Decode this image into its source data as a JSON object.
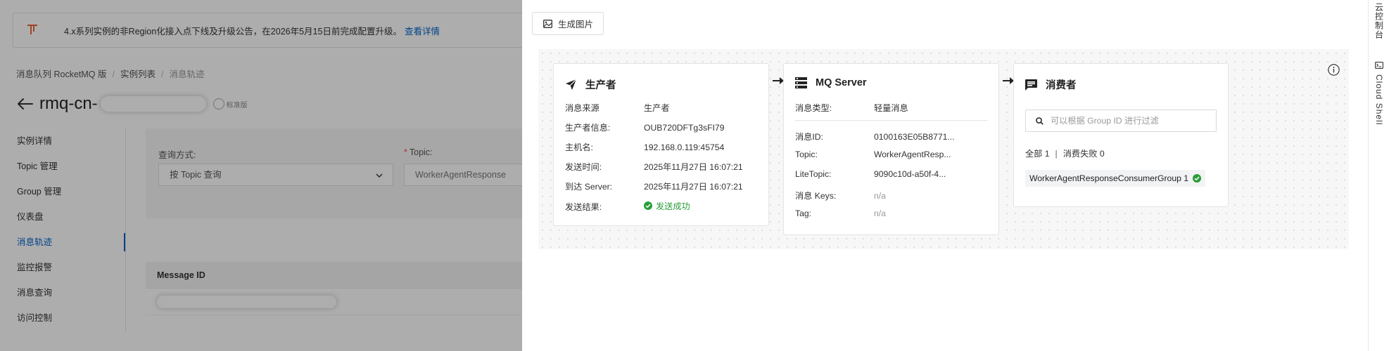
{
  "notice": {
    "text": "4.x系列实例的非Region化接入点下线及升级公告，在2026年5月15日前完成配置升级。",
    "link": "查看详情"
  },
  "breadcrumb": [
    "消息队列 RocketMQ 版",
    "实例列表",
    "消息轨迹"
  ],
  "instance": {
    "name": "rmq-cn-",
    "tag": "标准版"
  },
  "side_nav": {
    "items": [
      "实例详情",
      "Topic 管理",
      "Group 管理",
      "仪表盘",
      "消息轨迹",
      "监控报警",
      "消息查询",
      "访问控制"
    ],
    "active_index": 4
  },
  "query": {
    "method_label": "查询方式:",
    "method_value": "按 Topic 查询",
    "topic_label": "Topic:",
    "topic_value": "WorkerAgentResponse"
  },
  "table": {
    "header": "Message ID"
  },
  "drawer": {
    "generate_button": "生成图片",
    "producer": {
      "title": "生产者",
      "rows": [
        {
          "key": "消息来源",
          "value": "生产者"
        },
        {
          "key": "生产者信息:",
          "value": "OUB720DFTg3sFI79"
        },
        {
          "key": "主机名:",
          "value": "192.168.0.119:45754"
        },
        {
          "key": "发送时间:",
          "value": "2025年11月27日 16:07:21"
        },
        {
          "key": "到达 Server:",
          "value": "2025年11月27日 16:07:21"
        },
        {
          "key": "发送结果:",
          "value": "发送成功"
        }
      ]
    },
    "server": {
      "title": "MQ Server",
      "type_row": {
        "key": "消息类型:",
        "value": "轻量消息"
      },
      "rows": [
        {
          "key": "消息ID:",
          "value": "0100163E05B8771..."
        },
        {
          "key": "Topic:",
          "value": "WorkerAgentResp..."
        },
        {
          "key": "LiteTopic:",
          "value": "9090c10d-a50f-4..."
        },
        {
          "key": "消息 Keys:",
          "value": "n/a"
        },
        {
          "key": "Tag:",
          "value": "n/a"
        }
      ]
    },
    "consumer": {
      "title": "消费者",
      "search_placeholder": "可以根据 Group ID 进行过滤",
      "total_label": "全部 1",
      "separator": "|",
      "failed_label": "消费失败 0",
      "group": "WorkerAgentResponseConsumerGroup 1"
    }
  },
  "rail": {
    "console": "云控制台",
    "shell": "Cloud Shell"
  },
  "colors": {
    "link": "#0064c8",
    "success": "#2a9d3a",
    "notice_icon": "#e8663a"
  },
  "icons": [
    "notice-icon",
    "back-arrow-icon",
    "chevron-down-icon",
    "image-icon",
    "send-icon",
    "server-icon",
    "chat-icon",
    "search-icon",
    "check-circle-icon",
    "info-icon",
    "terminal-icon",
    "arrow-right-icon"
  ]
}
